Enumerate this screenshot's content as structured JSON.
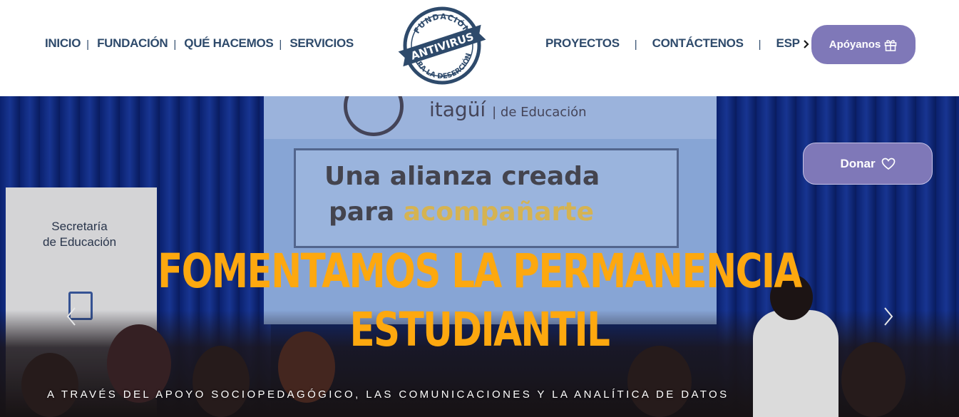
{
  "nav": {
    "left": [
      {
        "label": "INICIO"
      },
      {
        "label": "FUNDACIÓN"
      },
      {
        "label": "QUÉ HACEMOS"
      },
      {
        "label": "SERVICIOS"
      }
    ],
    "right": [
      {
        "label": "PROYECTOS"
      },
      {
        "label": "CONTÁCTENOS"
      }
    ],
    "separator": "|",
    "language": "ESP"
  },
  "logo": {
    "top_text": "FUNDACIÓN",
    "ribbon_text": "ANTIVIRUS",
    "bottom_text": "PARA LA DESERCIÓN"
  },
  "support_button": {
    "label": "Apóyanos",
    "icon": "gift-icon"
  },
  "hero": {
    "donate_label": "Donar",
    "donate_icon": "heart-icon",
    "headline_line1": "FOMENTAMOS LA PERMANENCIA",
    "headline_line2": "ESTUDIANTIL",
    "subheadline": "A TRAVÉS DEL APOYO SOCIOPEDAGÓGICO, LAS COMUNICACIONES Y LA ANALÍTICA DE DATOS",
    "photo": {
      "screen_brand": "itagüí",
      "screen_brand_sub": "| de Educación",
      "screen_line1": "Una alianza creada",
      "screen_line2_a": "para ",
      "screen_line2_b": "acompañarte",
      "banner_line1": "Secretaría",
      "banner_line2": "de Educación"
    }
  },
  "colors": {
    "nav_text": "#2e4a6b",
    "accent_purple": "#7f78b8",
    "headline_orange": "#fda80f"
  }
}
